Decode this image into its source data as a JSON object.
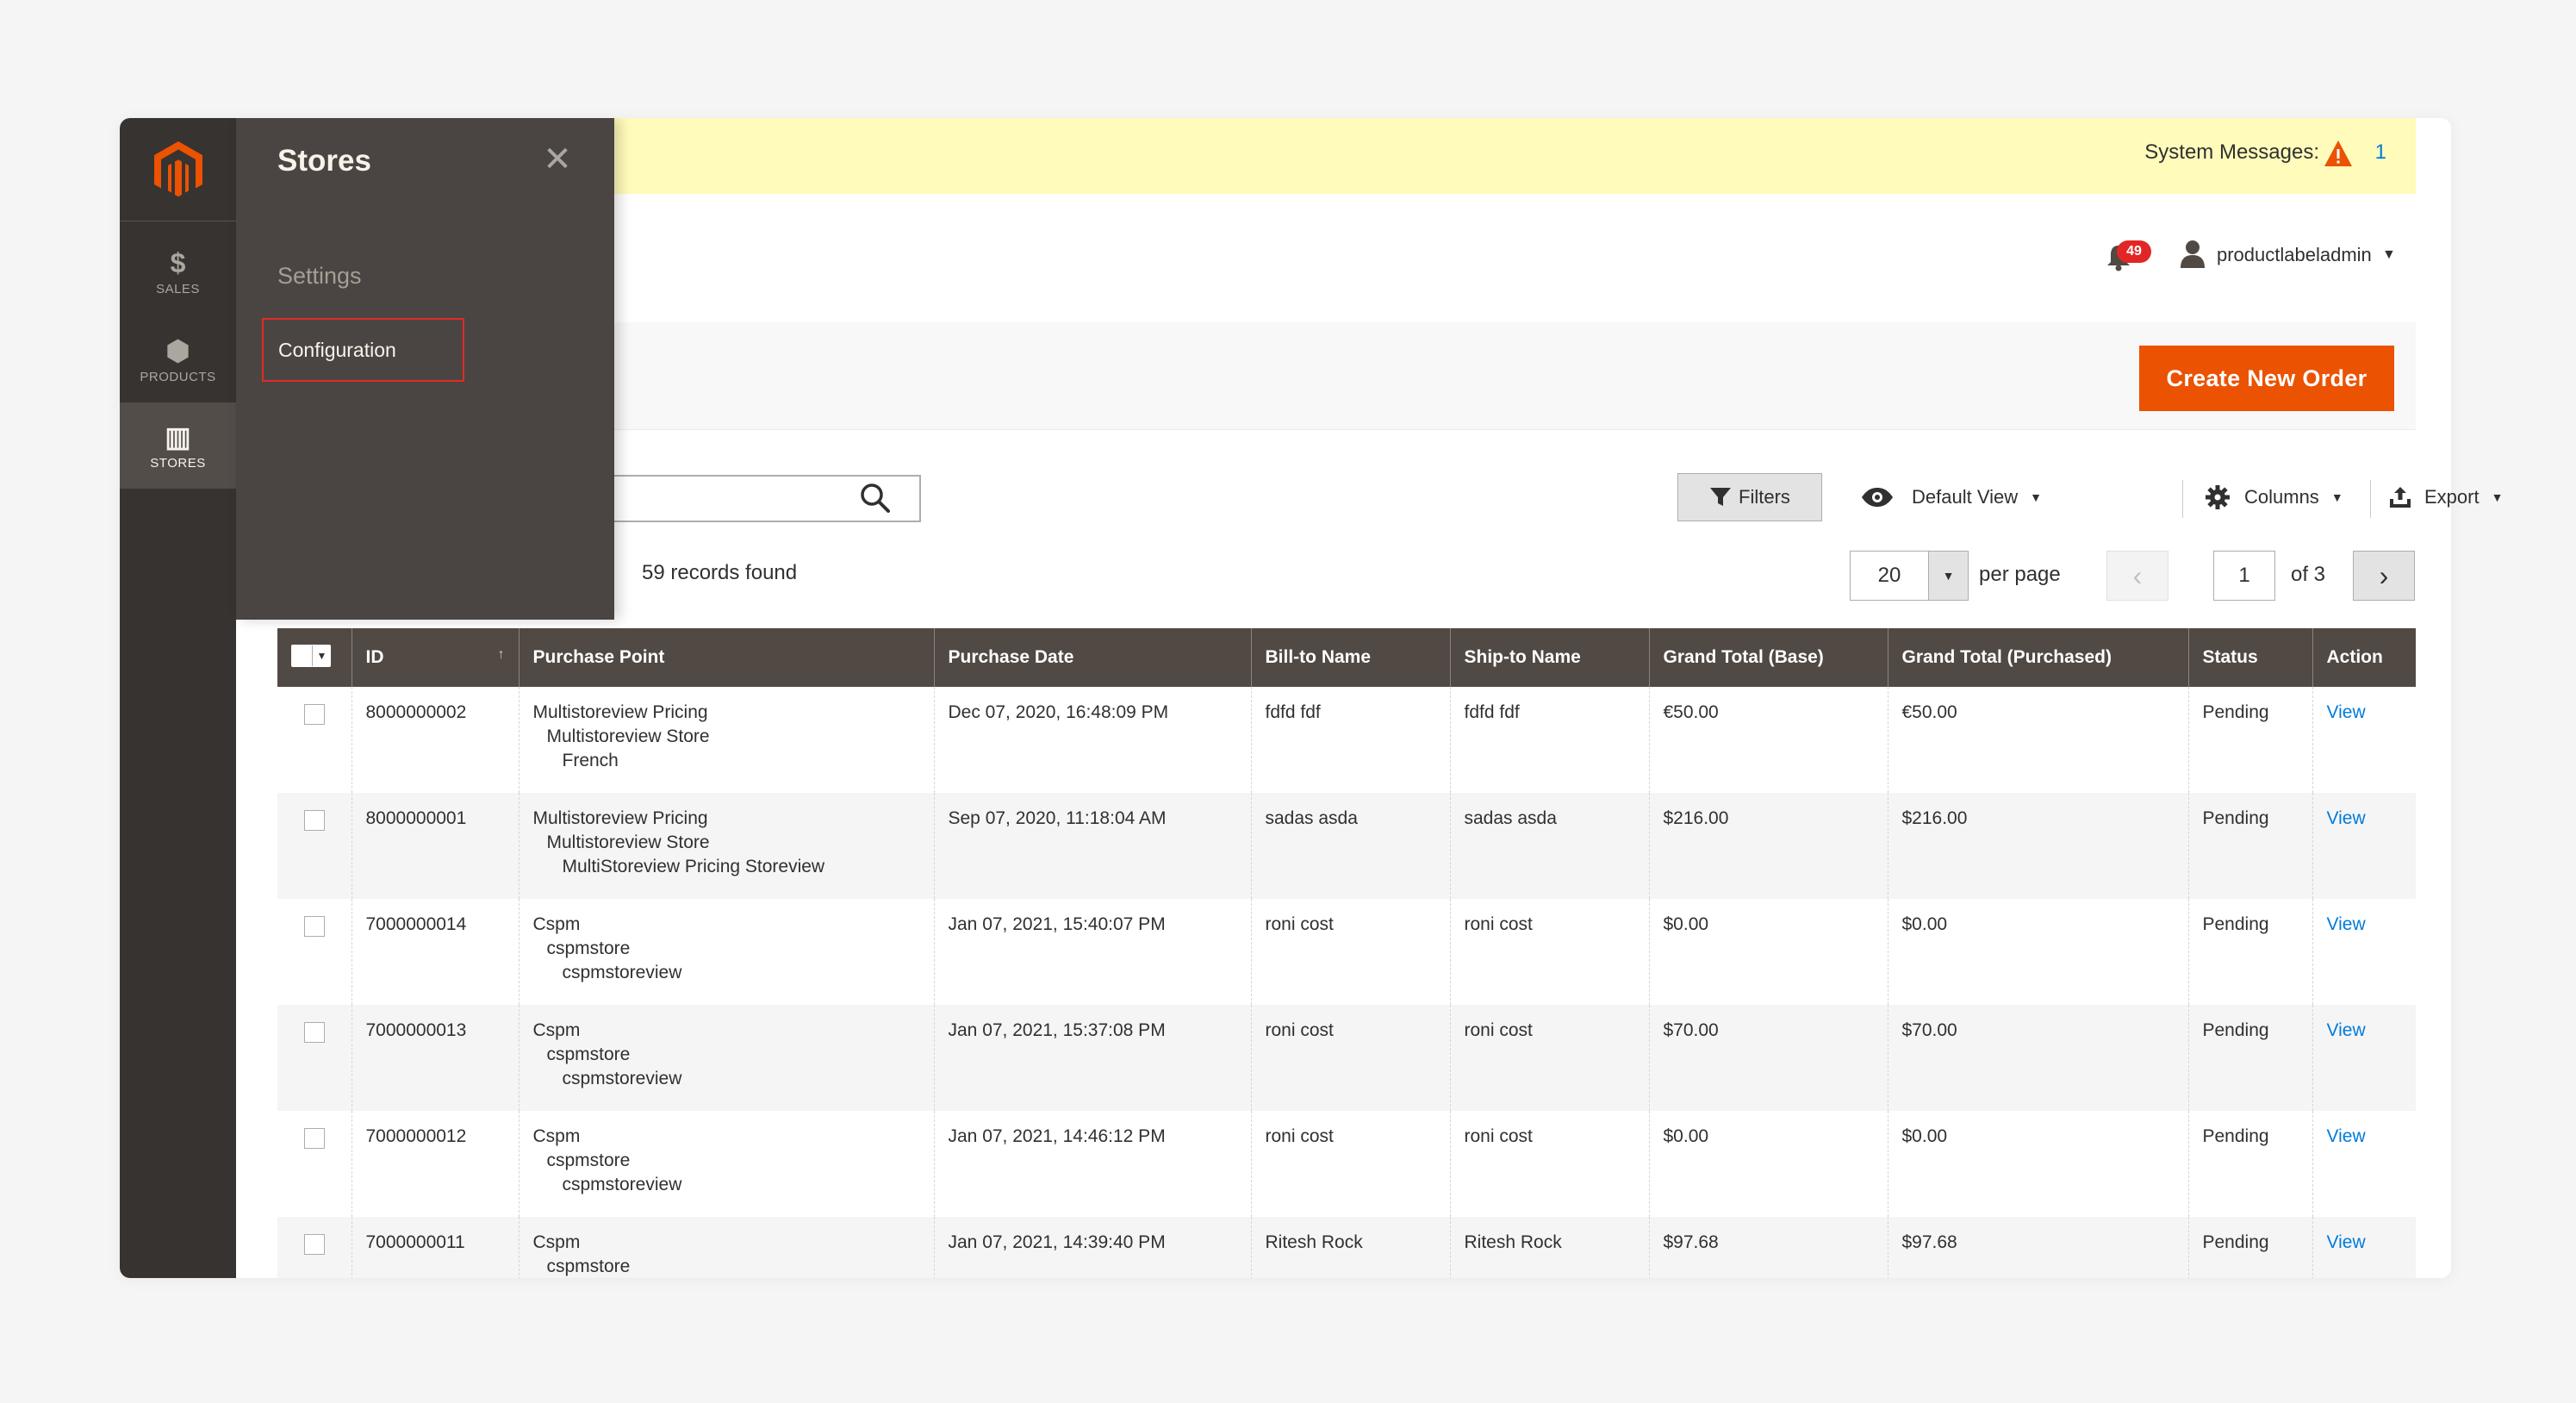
{
  "nav": {
    "items": [
      {
        "icon": "dollar-icon",
        "glyph": "$",
        "label": "SALES"
      },
      {
        "icon": "box-icon",
        "glyph": "⬢",
        "label": "PRODUCTS"
      },
      {
        "icon": "store-icon",
        "glyph": "▥",
        "label": "STORES"
      }
    ]
  },
  "flyout": {
    "title": "Stores",
    "section": "Settings",
    "link": "Configuration"
  },
  "system": {
    "label": "System Messages:",
    "count": "1"
  },
  "header": {
    "notifications": "49",
    "user": "productlabeladmin"
  },
  "actions": {
    "create_label": "Create New Order"
  },
  "toolbar": {
    "filters": "Filters",
    "view": "Default View",
    "columns": "Columns",
    "export": "Export",
    "records": "59 records found",
    "per_page_value": "20",
    "per_page_label": "per page",
    "page": "1",
    "page_of": "of 3"
  },
  "colors": {
    "accent": "#eb5202",
    "nav": "#373330",
    "header_row": "#514943",
    "link": "#007bdb"
  },
  "table": {
    "columns": [
      "ID",
      "Purchase Point",
      "Purchase Date",
      "Bill-to Name",
      "Ship-to Name",
      "Grand Total (Base)",
      "Grand Total (Purchased)",
      "Status",
      "Action"
    ],
    "rows": [
      {
        "id": "8000000002",
        "pp1": "Multistoreview Pricing",
        "pp2": "Multistoreview Store",
        "pp3": "French",
        "date": "Dec 07, 2020, 16:48:09 PM",
        "bill": "fdfd fdf",
        "ship": "fdfd fdf",
        "base": "€50.00",
        "purchased": "€50.00",
        "status": "Pending",
        "action": "View"
      },
      {
        "id": "8000000001",
        "pp1": "Multistoreview Pricing",
        "pp2": "Multistoreview Store",
        "pp3": "MultiStoreview Pricing Storeview",
        "date": "Sep 07, 2020, 11:18:04 AM",
        "bill": "sadas asda",
        "ship": "sadas asda",
        "base": "$216.00",
        "purchased": "$216.00",
        "status": "Pending",
        "action": "View"
      },
      {
        "id": "7000000014",
        "pp1": "Cspm",
        "pp2": "cspmstore",
        "pp3": "cspmstoreview",
        "date": "Jan 07, 2021, 15:40:07 PM",
        "bill": "roni cost",
        "ship": "roni cost",
        "base": "$0.00",
        "purchased": "$0.00",
        "status": "Pending",
        "action": "View"
      },
      {
        "id": "7000000013",
        "pp1": "Cspm",
        "pp2": "cspmstore",
        "pp3": "cspmstoreview",
        "date": "Jan 07, 2021, 15:37:08 PM",
        "bill": "roni cost",
        "ship": "roni cost",
        "base": "$70.00",
        "purchased": "$70.00",
        "status": "Pending",
        "action": "View"
      },
      {
        "id": "7000000012",
        "pp1": "Cspm",
        "pp2": "cspmstore",
        "pp3": "cspmstoreview",
        "date": "Jan 07, 2021, 14:46:12 PM",
        "bill": "roni cost",
        "ship": "roni cost",
        "base": "$0.00",
        "purchased": "$0.00",
        "status": "Pending",
        "action": "View"
      },
      {
        "id": "7000000011",
        "pp1": "Cspm",
        "pp2": "cspmstore",
        "pp3": "",
        "date": "Jan 07, 2021, 14:39:40 PM",
        "bill": "Ritesh Rock",
        "ship": "Ritesh Rock",
        "base": "$97.68",
        "purchased": "$97.68",
        "status": "Pending",
        "action": "View"
      }
    ]
  }
}
